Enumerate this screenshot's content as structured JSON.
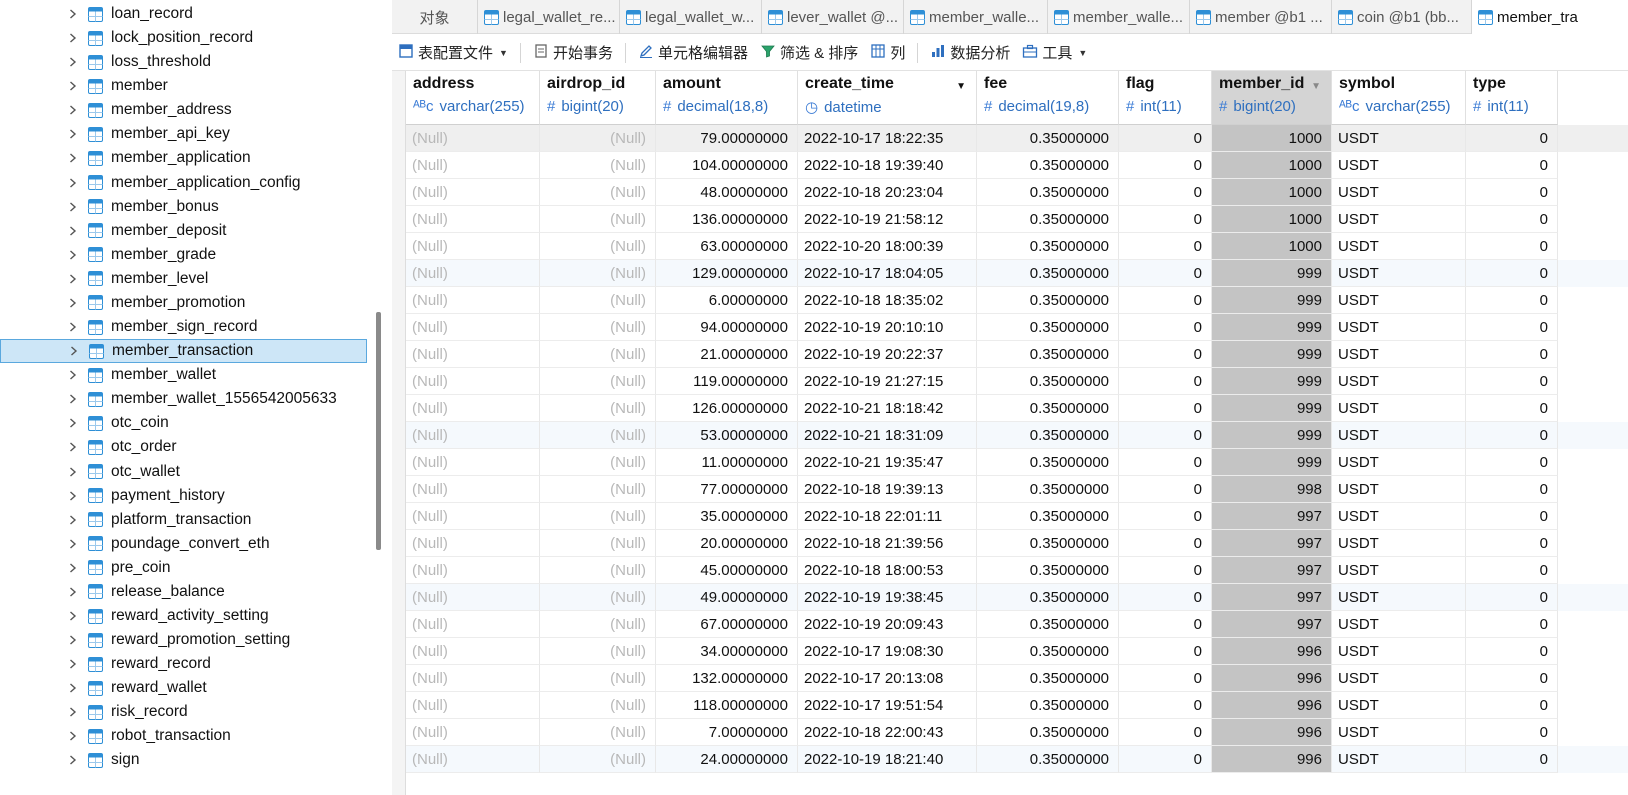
{
  "sidebar": {
    "items": [
      {
        "label": "loan_record"
      },
      {
        "label": "lock_position_record"
      },
      {
        "label": "loss_threshold"
      },
      {
        "label": "member"
      },
      {
        "label": "member_address"
      },
      {
        "label": "member_api_key"
      },
      {
        "label": "member_application"
      },
      {
        "label": "member_application_config"
      },
      {
        "label": "member_bonus"
      },
      {
        "label": "member_deposit"
      },
      {
        "label": "member_grade"
      },
      {
        "label": "member_level"
      },
      {
        "label": "member_promotion"
      },
      {
        "label": "member_sign_record"
      },
      {
        "label": "member_transaction",
        "selected": true
      },
      {
        "label": "member_wallet"
      },
      {
        "label": "member_wallet_1556542005633"
      },
      {
        "label": "otc_coin"
      },
      {
        "label": "otc_order"
      },
      {
        "label": "otc_wallet"
      },
      {
        "label": "payment_history"
      },
      {
        "label": "platform_transaction"
      },
      {
        "label": "poundage_convert_eth"
      },
      {
        "label": "pre_coin"
      },
      {
        "label": "release_balance"
      },
      {
        "label": "reward_activity_setting"
      },
      {
        "label": "reward_promotion_setting"
      },
      {
        "label": "reward_record"
      },
      {
        "label": "reward_wallet"
      },
      {
        "label": "risk_record"
      },
      {
        "label": "robot_transaction"
      },
      {
        "label": "sign"
      }
    ]
  },
  "tabs": [
    {
      "label": "对象",
      "kind": "objects"
    },
    {
      "label": "legal_wallet_re..."
    },
    {
      "label": "legal_wallet_w..."
    },
    {
      "label": "lever_wallet @..."
    },
    {
      "label": "member_walle..."
    },
    {
      "label": "member_walle..."
    },
    {
      "label": "member @b1 ..."
    },
    {
      "label": "coin @b1 (bb..."
    },
    {
      "label": "member_tra",
      "active": true
    }
  ],
  "toolbar": {
    "table_config": "表配置文件",
    "begin_transaction": "开始事务",
    "cell_editor": "单元格编辑器",
    "filter_sort": "筛选 & 排序",
    "columns": "列",
    "data_analysis": "数据分析",
    "tools": "工具"
  },
  "columns": [
    {
      "name": "address",
      "type": "varchar(255)",
      "type_icon": "text-type-icon"
    },
    {
      "name": "airdrop_id",
      "type": "bigint(20)",
      "type_icon": "number-type-icon"
    },
    {
      "name": "amount",
      "type": "decimal(18,8)",
      "type_icon": "number-type-icon"
    },
    {
      "name": "create_time",
      "type": "datetime",
      "type_icon": "clock-type-icon",
      "filter": true
    },
    {
      "name": "fee",
      "type": "decimal(19,8)",
      "type_icon": "number-type-icon"
    },
    {
      "name": "flag",
      "type": "int(11)",
      "type_icon": "number-type-icon"
    },
    {
      "name": "member_id",
      "type": "bigint(20)",
      "type_icon": "number-type-icon",
      "sorted": "desc"
    },
    {
      "name": "symbol",
      "type": "varchar(255)",
      "type_icon": "text-type-icon"
    },
    {
      "name": "type",
      "type": "int(11)",
      "type_icon": "number-type-icon"
    }
  ],
  "null_text": "(Null)",
  "rows": [
    {
      "amount": "79.00000000",
      "create_time": "2022-10-17 18:22:35",
      "fee": "0.35000000",
      "flag": "0",
      "member_id": "1000",
      "symbol": "USDT",
      "type": "0"
    },
    {
      "amount": "104.00000000",
      "create_time": "2022-10-18 19:39:40",
      "fee": "0.35000000",
      "flag": "0",
      "member_id": "1000",
      "symbol": "USDT",
      "type": "0"
    },
    {
      "amount": "48.00000000",
      "create_time": "2022-10-18 20:23:04",
      "fee": "0.35000000",
      "flag": "0",
      "member_id": "1000",
      "symbol": "USDT",
      "type": "0"
    },
    {
      "amount": "136.00000000",
      "create_time": "2022-10-19 21:58:12",
      "fee": "0.35000000",
      "flag": "0",
      "member_id": "1000",
      "symbol": "USDT",
      "type": "0"
    },
    {
      "amount": "63.00000000",
      "create_time": "2022-10-20 18:00:39",
      "fee": "0.35000000",
      "flag": "0",
      "member_id": "1000",
      "symbol": "USDT",
      "type": "0"
    },
    {
      "amount": "129.00000000",
      "create_time": "2022-10-17 18:04:05",
      "fee": "0.35000000",
      "flag": "0",
      "member_id": "999",
      "symbol": "USDT",
      "type": "0"
    },
    {
      "amount": "6.00000000",
      "create_time": "2022-10-18 18:35:02",
      "fee": "0.35000000",
      "flag": "0",
      "member_id": "999",
      "symbol": "USDT",
      "type": "0"
    },
    {
      "amount": "94.00000000",
      "create_time": "2022-10-19 20:10:10",
      "fee": "0.35000000",
      "flag": "0",
      "member_id": "999",
      "symbol": "USDT",
      "type": "0"
    },
    {
      "amount": "21.00000000",
      "create_time": "2022-10-19 20:22:37",
      "fee": "0.35000000",
      "flag": "0",
      "member_id": "999",
      "symbol": "USDT",
      "type": "0"
    },
    {
      "amount": "119.00000000",
      "create_time": "2022-10-19 21:27:15",
      "fee": "0.35000000",
      "flag": "0",
      "member_id": "999",
      "symbol": "USDT",
      "type": "0"
    },
    {
      "amount": "126.00000000",
      "create_time": "2022-10-21 18:18:42",
      "fee": "0.35000000",
      "flag": "0",
      "member_id": "999",
      "symbol": "USDT",
      "type": "0"
    },
    {
      "amount": "53.00000000",
      "create_time": "2022-10-21 18:31:09",
      "fee": "0.35000000",
      "flag": "0",
      "member_id": "999",
      "symbol": "USDT",
      "type": "0"
    },
    {
      "amount": "11.00000000",
      "create_time": "2022-10-21 19:35:47",
      "fee": "0.35000000",
      "flag": "0",
      "member_id": "999",
      "symbol": "USDT",
      "type": "0"
    },
    {
      "amount": "77.00000000",
      "create_time": "2022-10-18 19:39:13",
      "fee": "0.35000000",
      "flag": "0",
      "member_id": "998",
      "symbol": "USDT",
      "type": "0"
    },
    {
      "amount": "35.00000000",
      "create_time": "2022-10-18 22:01:11",
      "fee": "0.35000000",
      "flag": "0",
      "member_id": "997",
      "symbol": "USDT",
      "type": "0"
    },
    {
      "amount": "20.00000000",
      "create_time": "2022-10-18 21:39:56",
      "fee": "0.35000000",
      "flag": "0",
      "member_id": "997",
      "symbol": "USDT",
      "type": "0"
    },
    {
      "amount": "45.00000000",
      "create_time": "2022-10-18 18:00:53",
      "fee": "0.35000000",
      "flag": "0",
      "member_id": "997",
      "symbol": "USDT",
      "type": "0"
    },
    {
      "amount": "49.00000000",
      "create_time": "2022-10-19 19:38:45",
      "fee": "0.35000000",
      "flag": "0",
      "member_id": "997",
      "symbol": "USDT",
      "type": "0"
    },
    {
      "amount": "67.00000000",
      "create_time": "2022-10-19 20:09:43",
      "fee": "0.35000000",
      "flag": "0",
      "member_id": "997",
      "symbol": "USDT",
      "type": "0"
    },
    {
      "amount": "34.00000000",
      "create_time": "2022-10-17 19:08:30",
      "fee": "0.35000000",
      "flag": "0",
      "member_id": "996",
      "symbol": "USDT",
      "type": "0"
    },
    {
      "amount": "132.00000000",
      "create_time": "2022-10-17 20:13:08",
      "fee": "0.35000000",
      "flag": "0",
      "member_id": "996",
      "symbol": "USDT",
      "type": "0"
    },
    {
      "amount": "118.00000000",
      "create_time": "2022-10-17 19:51:54",
      "fee": "0.35000000",
      "flag": "0",
      "member_id": "996",
      "symbol": "USDT",
      "type": "0"
    },
    {
      "amount": "7.00000000",
      "create_time": "2022-10-18 22:00:43",
      "fee": "0.35000000",
      "flag": "0",
      "member_id": "996",
      "symbol": "USDT",
      "type": "0"
    },
    {
      "amount": "24.00000000",
      "create_time": "2022-10-19 18:21:40",
      "fee": "0.35000000",
      "flag": "0",
      "member_id": "996",
      "symbol": "USDT",
      "type": "0"
    }
  ],
  "colors": {
    "accent": "#2e6fbf",
    "selection": "#cde6f7",
    "sorted_column": "#c4c4c4",
    "null_text": "#b8b8b8"
  }
}
